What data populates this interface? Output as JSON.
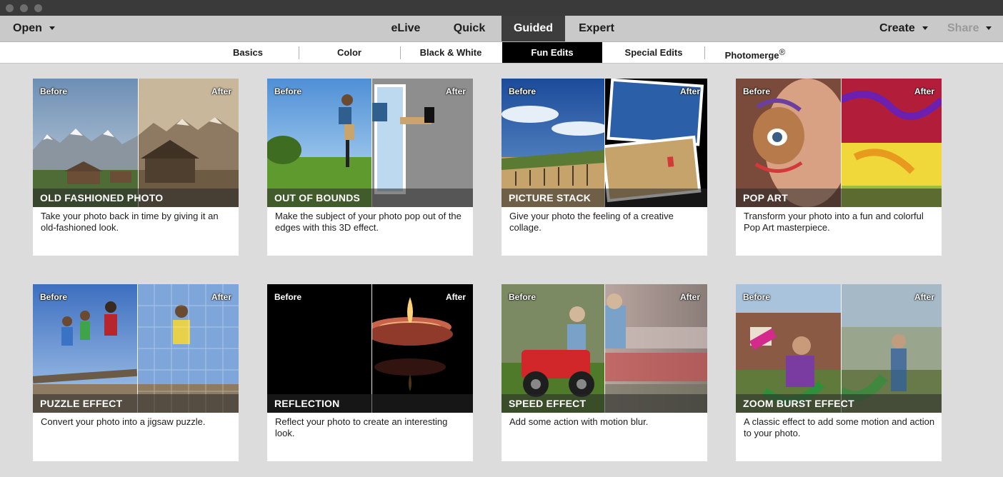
{
  "window": {
    "traffic_light_color": "#6e6e6e"
  },
  "topbar": {
    "open_label": "Open",
    "modes": [
      {
        "label": "eLive"
      },
      {
        "label": "Quick"
      },
      {
        "label": "Guided"
      },
      {
        "label": "Expert"
      }
    ],
    "active_mode": "Guided",
    "create_label": "Create",
    "share_label": "Share"
  },
  "subtabs": {
    "items": [
      {
        "label": "Basics"
      },
      {
        "label": "Color"
      },
      {
        "label": "Black & White"
      },
      {
        "label": "Fun Edits"
      },
      {
        "label": "Special Edits"
      },
      {
        "label": "Photomerge"
      }
    ],
    "active": "Fun Edits",
    "registered_mark": "®"
  },
  "labels": {
    "before": "Before",
    "after": "After"
  },
  "cards": [
    {
      "title": "OLD FASHIONED PHOTO",
      "description": "Take your photo back in time by giving it an old-fashioned look.",
      "icon": "mountain-barn-image"
    },
    {
      "title": "OUT OF BOUNDS",
      "description": "Make the subject of your photo pop out of the edges with this 3D effect.",
      "icon": "jumping-boy-image"
    },
    {
      "title": "PICTURE STACK",
      "description": "Give your photo the feeling of a creative collage.",
      "icon": "beach-fence-image"
    },
    {
      "title": "POP ART",
      "description": "Transform your photo into a fun and colorful Pop Art masterpiece.",
      "icon": "painted-face-image"
    },
    {
      "title": "PUZZLE EFFECT",
      "description": "Convert your photo into a jigsaw puzzle.",
      "icon": "jumping-kids-image"
    },
    {
      "title": "REFLECTION",
      "description": "Reflect your photo to create an interesting look.",
      "icon": "candle-image"
    },
    {
      "title": "SPEED EFFECT",
      "description": "Add some action with motion blur.",
      "icon": "toy-car-boy-image"
    },
    {
      "title": "ZOOM BURST EFFECT",
      "description": "A classic effect to add some motion and action to your photo.",
      "icon": "girl-swing-image"
    }
  ]
}
